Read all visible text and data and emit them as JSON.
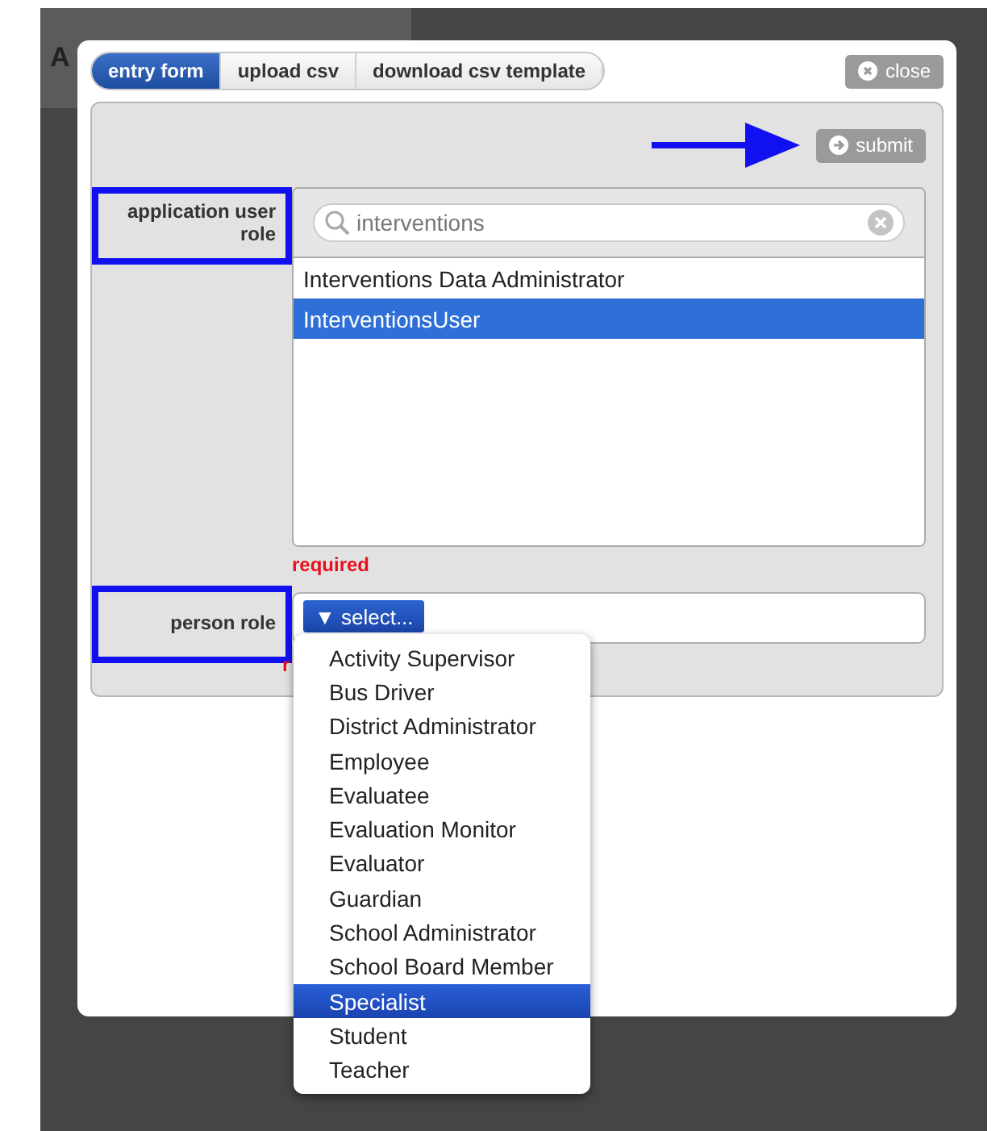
{
  "background": {
    "heading": "A"
  },
  "tabs": [
    {
      "label": "entry form",
      "selected": true
    },
    {
      "label": "upload csv",
      "selected": false
    },
    {
      "label": "download csv template",
      "selected": false
    }
  ],
  "close_button": "close",
  "submit_button": "submit",
  "fields": [
    {
      "kind": "picker",
      "label": "application user role",
      "search": {
        "value": "interventions"
      },
      "options": [
        {
          "label": "Interventions Data Administrator",
          "selected": false
        },
        {
          "label": "InterventionsUser",
          "selected": true
        }
      ],
      "error": "required"
    },
    {
      "kind": "select",
      "label": "person role",
      "button": "▼ select...",
      "error": "r"
    }
  ],
  "dropdown": {
    "items": [
      {
        "label": "Activity Supervisor",
        "selected": false
      },
      {
        "label": "Bus Driver",
        "selected": false
      },
      {
        "label": "District Administrator",
        "selected": false
      },
      {
        "label": "Employee",
        "selected": false
      },
      {
        "label": "Evaluatee",
        "selected": false
      },
      {
        "label": "Evaluation Monitor",
        "selected": false
      },
      {
        "label": "Evaluator",
        "selected": false
      },
      {
        "label": "Guardian",
        "selected": false
      },
      {
        "label": "School Administrator",
        "selected": false
      },
      {
        "label": "School Board Member",
        "selected": false
      },
      {
        "label": "Specialist",
        "selected": true
      },
      {
        "label": "Student",
        "selected": false
      },
      {
        "label": "Teacher",
        "selected": false
      }
    ]
  }
}
